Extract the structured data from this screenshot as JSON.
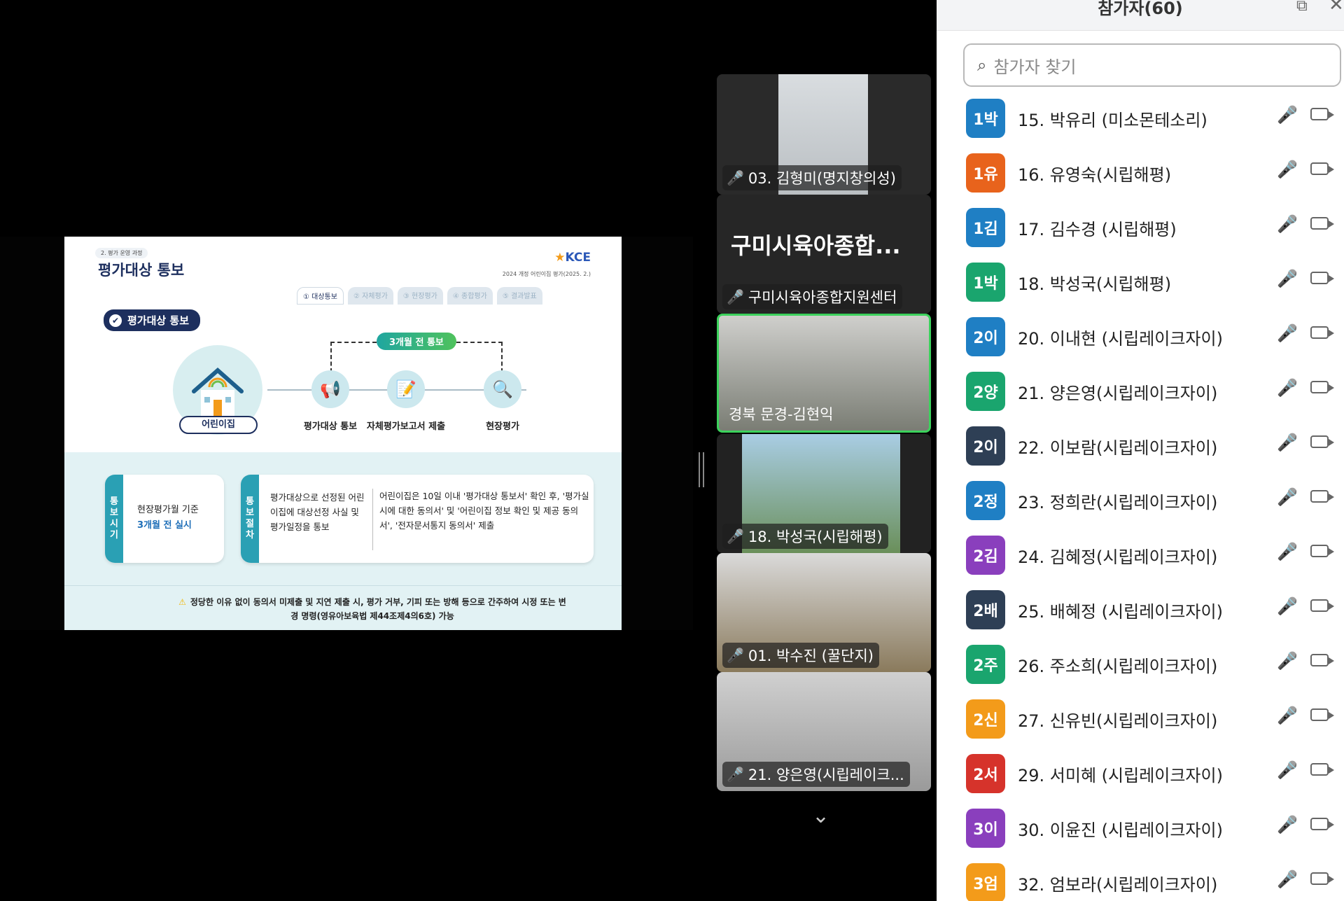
{
  "slide": {
    "section": "2. 평가 운영 과정",
    "title": "평가대상 통보",
    "logo": "KCE",
    "logo_sub": "2024 개정 어린이집 평가(2025. 2.)",
    "tabs": [
      "① 대상통보",
      "② 자체평가",
      "③ 현장평가",
      "④ 종합평가",
      "⑤ 결과발표"
    ],
    "heading": "평가대상 통보",
    "badge": "3개월 전 통보",
    "house_label": "어린이집",
    "steps": [
      "평가대상 통보",
      "자체평가보고서 제출",
      "현장평가"
    ],
    "box1_tab": "통보시기",
    "box1_line1": "현장평가월 기준",
    "box1_line2": "3개월 전 실시",
    "box2_tab": "통보절차",
    "box2_left": "평가대상으로 선정된 어린이집에 대상선정 사실 및 평가일정을 통보",
    "box2_right": "어린이집은 10일 이내 '평가대상 통보서' 확인 후, '평가실시에 대한 동의서' 및 '어린이집 정보 확인 및 제공 동의서', '전자문서통지 동의서' 제출",
    "warning": "정당한 이유 없이 동의서 미제출 및 지연 제출 시, 평가 거부, 기피 또는 방해 등으로 간주하여 시정 또는 변경 명령(영유아보육법 제44조제4의6호) 가능"
  },
  "videos": [
    {
      "name": "03. 김형미(명지창의성)"
    },
    {
      "big": "구미시육아종합...",
      "name": "구미시육아종합지원센터"
    },
    {
      "name": "경북 문경-김현익"
    },
    {
      "name": "18. 박성국(시립해평)"
    },
    {
      "name": "01. 박수진 (꿀단지)"
    },
    {
      "name": "21. 양은영(시립레이크..."
    }
  ],
  "panel": {
    "title": "참가자(60)",
    "search_placeholder": "참가자 찾기",
    "participants": [
      {
        "avatar": "1박",
        "color": "#1f7fc4",
        "name": "15. 박유리 (미소몬테소리)"
      },
      {
        "avatar": "1유",
        "color": "#e8631c",
        "name": "16. 유영숙(시립해평)"
      },
      {
        "avatar": "1김",
        "color": "#1f7fc4",
        "name": "17. 김수경 (시립해평)"
      },
      {
        "avatar": "1박",
        "color": "#1aa56e",
        "name": "18. 박성국(시립해평)"
      },
      {
        "avatar": "2이",
        "color": "#1f7fc4",
        "name": "20. 이내현 (시립레이크자이)"
      },
      {
        "avatar": "2양",
        "color": "#1aa56e",
        "name": "21. 양은영(시립레이크자이)"
      },
      {
        "avatar": "2이",
        "color": "#2e3f55",
        "name": "22. 이보람(시립레이크자이)"
      },
      {
        "avatar": "2정",
        "color": "#1f7fc4",
        "name": "23. 정희란(시립레이크자이)"
      },
      {
        "avatar": "2김",
        "color": "#8a3fbd",
        "name": "24. 김혜정(시립레이크자이)"
      },
      {
        "avatar": "2배",
        "color": "#2e3f55",
        "name": "25. 배혜정 (시립레이크자이)"
      },
      {
        "avatar": "2주",
        "color": "#1aa56e",
        "name": "26. 주소희(시립레이크자이)"
      },
      {
        "avatar": "2신",
        "color": "#f39b1a",
        "name": "27. 신유빈(시립레이크자이)"
      },
      {
        "avatar": "2서",
        "color": "#d6332b",
        "name": "29. 서미혜 (시립레이크자이)"
      },
      {
        "avatar": "3이",
        "color": "#8a3fbd",
        "name": "30. 이윤진 (시립레이크자이)"
      },
      {
        "avatar": "3엄",
        "color": "#f39b1a",
        "name": "32. 엄보라(시립레이크자이)"
      }
    ]
  }
}
